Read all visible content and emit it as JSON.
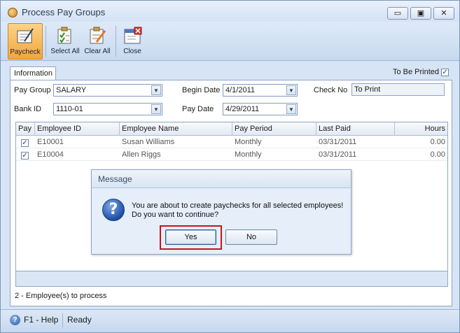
{
  "window": {
    "title": "Process Pay Groups"
  },
  "window_controls": {
    "minimize": "▭",
    "restore": "▣",
    "close": "✕"
  },
  "toolbar": {
    "paycheck": "Paycheck",
    "select_all": "Select All",
    "clear_all": "Clear All",
    "close": "Close"
  },
  "tabs": {
    "information": "Information"
  },
  "options": {
    "to_be_printed_label": "To Be Printed",
    "to_be_printed_checked": true,
    "check_mark": "✓"
  },
  "form": {
    "pay_group_label": "Pay Group",
    "pay_group_value": "SALARY",
    "bank_id_label": "Bank ID",
    "bank_id_value": "1110-01",
    "begin_date_label": "Begin Date",
    "begin_date_value": "4/1/2011",
    "pay_date_label": "Pay Date",
    "pay_date_value": "4/29/2011",
    "check_no_label": "Check No",
    "check_no_value": "To Print",
    "dropdown_glyph": "▼"
  },
  "grid": {
    "columns": [
      "Pay",
      "Employee ID",
      "Employee Name",
      "Pay Period",
      "Last Paid",
      "Hours"
    ],
    "rows": [
      {
        "pay": "✓",
        "employee_id": "E10001",
        "employee_name": "Susan Williams",
        "pay_period": "Monthly",
        "last_paid": "03/31/2011",
        "hours": "0.00"
      },
      {
        "pay": "✓",
        "employee_id": "E10004",
        "employee_name": "Allen Riggs",
        "pay_period": "Monthly",
        "last_paid": "03/31/2011",
        "hours": "0.00"
      }
    ]
  },
  "summary": {
    "employees_to_process": "2 -  Employee(s) to process"
  },
  "statusbar": {
    "help_glyph": "?",
    "help": "F1 - Help",
    "status": "Ready"
  },
  "dialog": {
    "title": "Message",
    "icon_glyph": "?",
    "message_line1": "You are about to create paychecks for all selected employees!",
    "message_line2": "Do you want to continue?",
    "yes_label": "Yes",
    "no_label": "No"
  },
  "colors": {
    "highlight": "#c4161c",
    "active_tool": "#f4a63a"
  }
}
